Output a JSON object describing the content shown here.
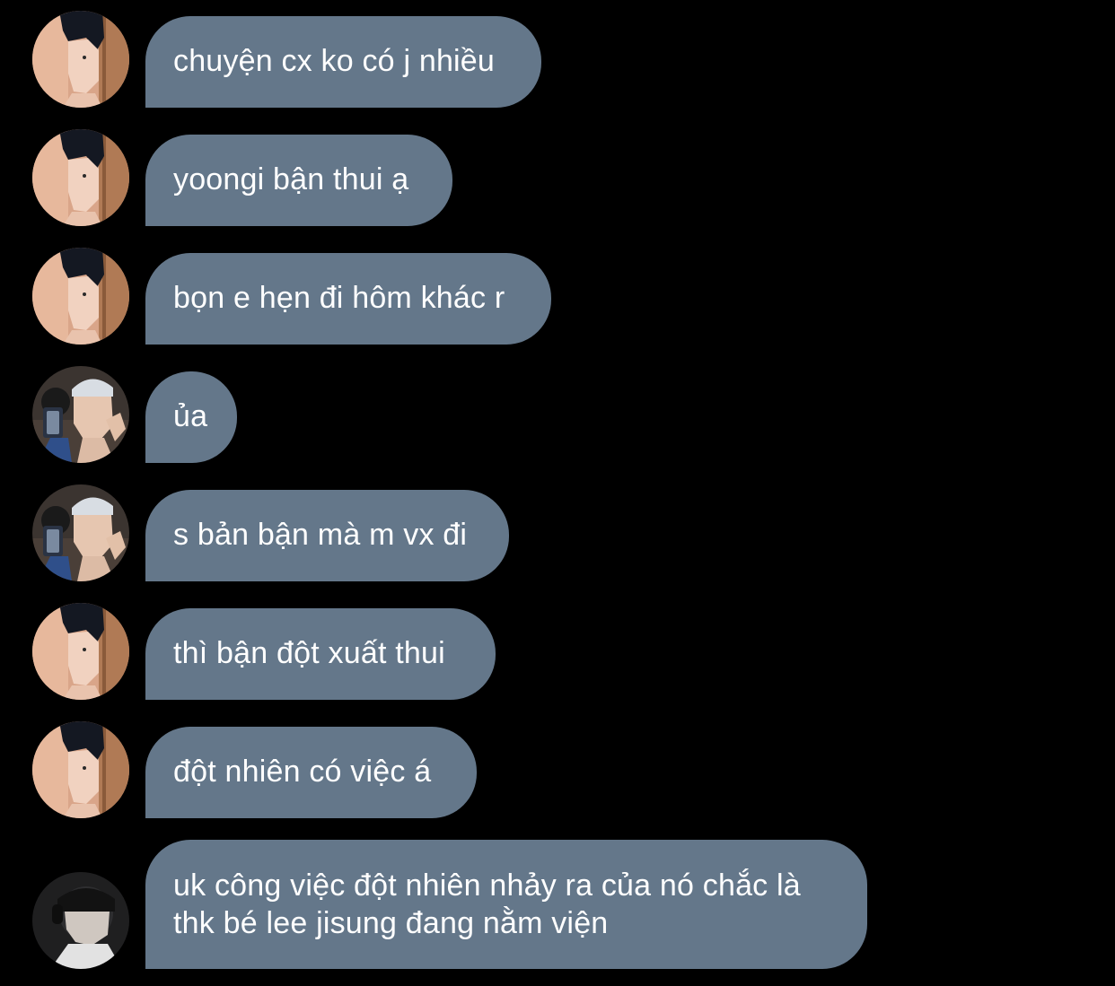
{
  "messages": [
    {
      "sender": "user-a",
      "text": "chuyện cx ko có j nhiều"
    },
    {
      "sender": "user-a",
      "text": "yoongi bận thui ạ"
    },
    {
      "sender": "user-a",
      "text": "bọn e hẹn đi hôm khác r"
    },
    {
      "sender": "user-b",
      "text": "ủa"
    },
    {
      "sender": "user-b",
      "text": "s bản bận mà m vx đi"
    },
    {
      "sender": "user-a",
      "text": "thì bận đột xuất thui"
    },
    {
      "sender": "user-a",
      "text": "đột nhiên có việc á"
    },
    {
      "sender": "user-c",
      "text": "uk công việc đột nhiên nhảy ra của nó chắc là\nthk bé lee jisung đang nằm viện"
    }
  ],
  "colors": {
    "background": "#000000",
    "bubble": "#64778a",
    "text": "#ffffff"
  },
  "avatars": {
    "user-a": "profile-photo-dark-hair-wooden-door",
    "user-b": "profile-photo-mirror-selfie-headband",
    "user-c": "profile-photo-headphones-dark"
  }
}
